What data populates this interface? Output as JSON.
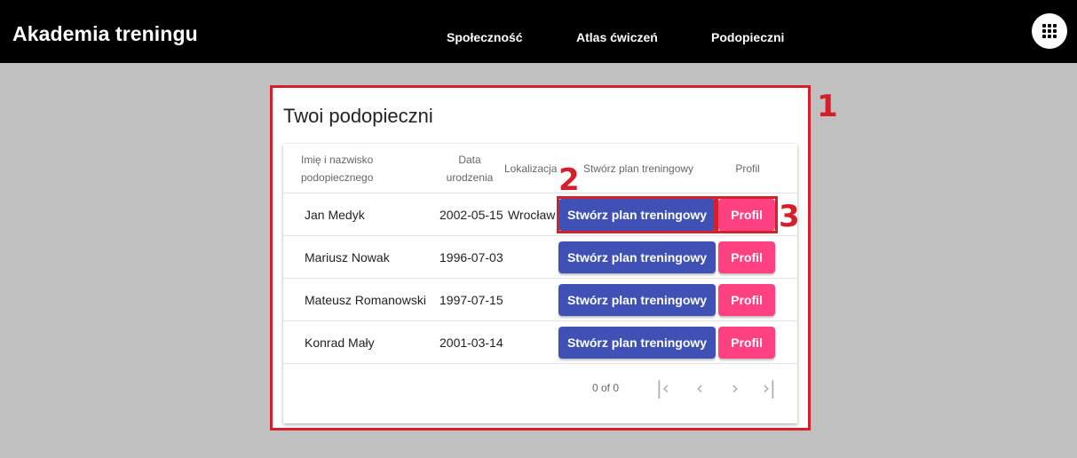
{
  "header": {
    "brand": "Akademia treningu",
    "nav": [
      "Społeczność",
      "Atlas ćwiczeń",
      "Podopieczni"
    ],
    "apps_icon": "apps-grid-icon"
  },
  "main": {
    "title": "Twoi podopieczni",
    "columns": {
      "name": "Imię i nazwisko podopiecznego",
      "birth": "Data urodzenia",
      "location": "Lokalizacja",
      "plan": "Stwórz plan treningowy",
      "profile": "Profil"
    },
    "rows": [
      {
        "name": "Jan Medyk",
        "birth": "2002-05-15",
        "location": "Wrocław",
        "plan": "Stwórz plan treningowy",
        "profile": "Profil"
      },
      {
        "name": "Mariusz Nowak",
        "birth": "1996-07-03",
        "location": "",
        "plan": "Stwórz plan treningowy",
        "profile": "Profil"
      },
      {
        "name": "Mateusz Romanowski",
        "birth": "1997-07-15",
        "location": "",
        "plan": "Stwórz plan treningowy",
        "profile": "Profil"
      },
      {
        "name": "Konrad Mały",
        "birth": "2001-03-14",
        "location": "",
        "plan": "Stwórz plan treningowy",
        "profile": "Profil"
      }
    ],
    "paginator": {
      "range": "0 of 0",
      "first_icon": "first-page-icon",
      "prev_icon": "chevron-left-icon",
      "next_icon": "chevron-right-icon",
      "last_icon": "last-page-icon"
    }
  },
  "annotations": {
    "labels": [
      "1",
      "2",
      "3"
    ],
    "color": "#d4202a"
  },
  "colors": {
    "header_bg": "#000000",
    "primary": "#3f51b5",
    "accent": "#ff4081",
    "page_bg": "#c0c0c0"
  }
}
